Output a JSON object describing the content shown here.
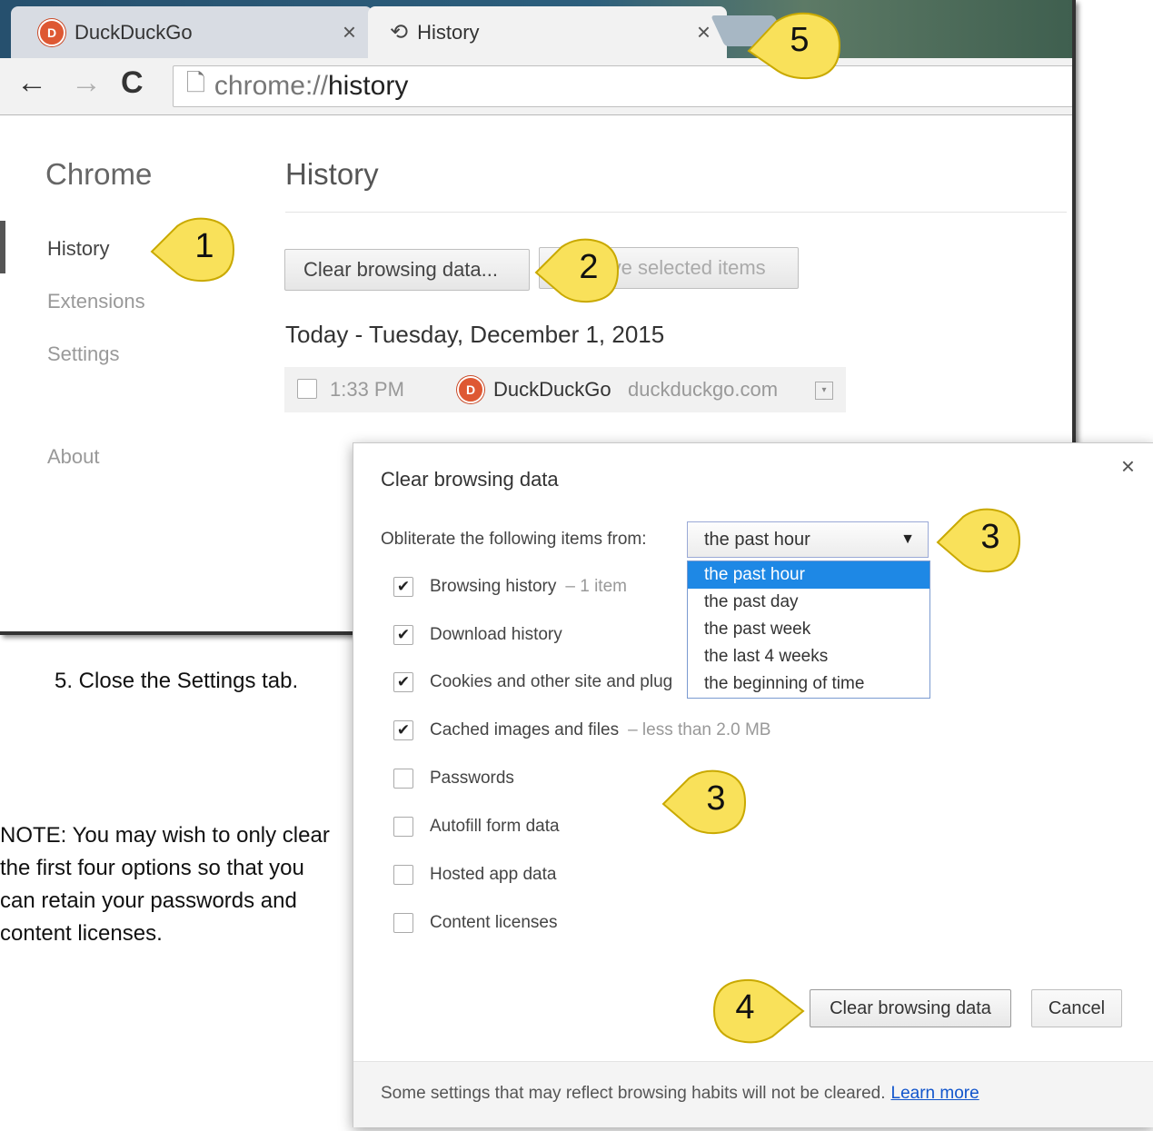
{
  "browser": {
    "tabs": [
      {
        "label": "DuckDuckGo",
        "close": "×"
      },
      {
        "label": "History",
        "close": "×"
      }
    ],
    "omnibox": {
      "scheme": "chrome://",
      "path": "history"
    },
    "nav": {
      "back": "←",
      "forward": "→",
      "reload": "C"
    }
  },
  "sidebar": {
    "title": "Chrome",
    "items": [
      {
        "label": "History"
      },
      {
        "label": "Extensions"
      },
      {
        "label": "Settings"
      },
      {
        "label": "About"
      }
    ]
  },
  "history_page": {
    "title": "History",
    "clear_button": "Clear browsing data...",
    "remove_button": "Remove selected items",
    "date_heading": "Today - Tuesday, December 1, 2015",
    "entry": {
      "time": "1:33 PM",
      "site": "DuckDuckGo",
      "domain": "duckduckgo.com"
    }
  },
  "dialog": {
    "title": "Clear browsing data",
    "close": "×",
    "range_label": "Obliterate the following items from:",
    "range_selected": "the past hour",
    "range_options": [
      "the past hour",
      "the past day",
      "the past week",
      "the last 4 weeks",
      "the beginning of time"
    ],
    "checkboxes": [
      {
        "label": "Browsing history",
        "note": "– 1 item",
        "checked": true
      },
      {
        "label": "Download history",
        "note": "",
        "checked": true
      },
      {
        "label": "Cookies and other site and plug",
        "note": "",
        "checked": true
      },
      {
        "label": "Cached images and files",
        "note": "– less than 2.0 MB",
        "checked": true
      },
      {
        "label": "Passwords",
        "note": "",
        "checked": false
      },
      {
        "label": "Autofill form data",
        "note": "",
        "checked": false
      },
      {
        "label": "Hosted app data",
        "note": "",
        "checked": false
      },
      {
        "label": "Content licenses",
        "note": "",
        "checked": false
      }
    ],
    "confirm_button": "Clear browsing data",
    "cancel_button": "Cancel",
    "footer_text": "Some settings that may reflect browsing habits will not be cleared.",
    "footer_link": "Learn more"
  },
  "instructions": {
    "step5": "5.  Close the Settings tab.",
    "note": "NOTE: You may wish to only clear the first four options so that you can retain your passwords and content licenses."
  },
  "callouts": [
    "1",
    "2",
    "3",
    "3",
    "4",
    "5"
  ],
  "colors": {
    "callout_fill": "#f9e15a",
    "selected_option": "#1e88e5",
    "link": "#1155cc"
  }
}
